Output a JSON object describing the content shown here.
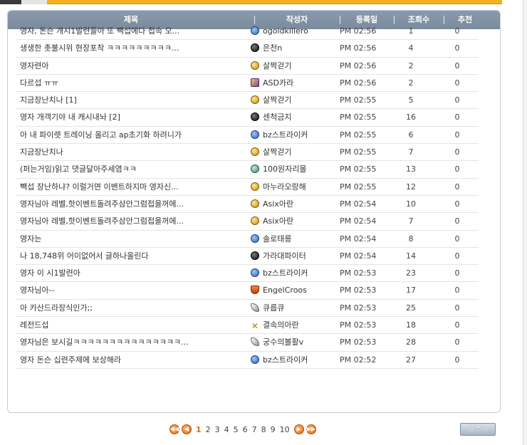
{
  "table": {
    "headers": {
      "title": "제목",
      "author": "작성자",
      "date": "등록일",
      "views": "조회수",
      "recommend": "추천"
    },
    "rows": [
      {
        "title": "영자, 돈슨 개시1발련들아 또 빽섭에다 접속 오...",
        "author": "ogoldkillero",
        "icon": "globe",
        "date": "PM 02:56",
        "views": "1",
        "recommend": "0"
      },
      {
        "title": "생생한 촛불시위 현장포착 ㅋㅋㅋㅋㅋㅋㅋㅋㅋ...",
        "author": "은천n",
        "icon": "round",
        "date": "PM 02:56",
        "views": "4",
        "recommend": "0"
      },
      {
        "title": "영자련아",
        "author": "살짝걷기",
        "icon": "gold",
        "date": "PM 02:56",
        "views": "2",
        "recommend": "0"
      },
      {
        "title": "다르섭 ㅠㅠ",
        "author": "ASD카라",
        "icon": "purple",
        "date": "PM 02:56",
        "views": "2",
        "recommend": "0"
      },
      {
        "title": "지금장난치나 [1]",
        "author": "살짝걷기",
        "icon": "gold",
        "date": "PM 02:55",
        "views": "5",
        "recommend": "0"
      },
      {
        "title": "영자 개객기야 내 캐시내놔 [2]",
        "author": "센척금지",
        "icon": "round",
        "date": "PM 02:55",
        "views": "16",
        "recommend": "0"
      },
      {
        "title": "아 내 파이렛 트레이닝 올리고 ap초기화 하려니가",
        "author": "bz스트라이커",
        "icon": "globe",
        "date": "PM 02:55",
        "views": "6",
        "recommend": "0"
      },
      {
        "title": "지금장난치나",
        "author": "살짝걷기",
        "icon": "gold",
        "date": "PM 02:55",
        "views": "7",
        "recommend": "0"
      },
      {
        "title": "(퍼는거임)읽고 댓글달아주세염ㅋㅋ",
        "author": "100원자리몰",
        "icon": "cyan",
        "date": "PM 02:55",
        "views": "13",
        "recommend": "0"
      },
      {
        "title": "빽섭 장난하냐? 이럴거면 이밴트하지마 영자신...",
        "author": "마누라오랑해",
        "icon": "gold",
        "date": "PM 02:55",
        "views": "12",
        "recommend": "0"
      },
      {
        "title": "영자님아 레벨,핫이벤트돌려주삼안그럼접을꺼에...",
        "author": "Asix아란",
        "icon": "gold",
        "date": "PM 02:54",
        "views": "10",
        "recommend": "0"
      },
      {
        "title": "영자님아 레벨,핫이벤트돌려주삼안그럼접을꺼에...",
        "author": "Asix아란",
        "icon": "gold",
        "date": "PM 02:54",
        "views": "7",
        "recommend": "0"
      },
      {
        "title": "영자는",
        "author": "솔로태릉",
        "icon": "globe",
        "date": "PM 02:54",
        "views": "8",
        "recommend": "0"
      },
      {
        "title": "나 18,748위 어이없어서 글하나올린다",
        "author": "가라대파이터",
        "icon": "round",
        "date": "PM 02:54",
        "views": "14",
        "recommend": "0"
      },
      {
        "title": "영자 이 시1발련아",
        "author": "bz스트라이커",
        "icon": "globe",
        "date": "PM 02:53",
        "views": "23",
        "recommend": "0"
      },
      {
        "title": "영자님아--",
        "author": "EngelCroos",
        "icon": "shield",
        "date": "PM 02:53",
        "views": "17",
        "recommend": "0"
      },
      {
        "title": "아 카산드라장식인가;;",
        "author": "큐릅큐",
        "icon": "feather",
        "date": "PM 02:53",
        "views": "25",
        "recommend": "0"
      },
      {
        "title": "레전드섭",
        "author": "결속의아란",
        "icon": "cross",
        "date": "PM 02:53",
        "views": "18",
        "recommend": "0"
      },
      {
        "title": "영자님은 보시길ㅋㅋㅋㅋㅋㅋㅋㅋㅋㅋㅋㅋㅋㅋㅋ...",
        "author": "궁수의볼활v",
        "icon": "feather",
        "date": "PM 02:53",
        "views": "28",
        "recommend": "0"
      },
      {
        "title": "영자 돈슨 십련주제에 보상해라",
        "author": "bz스트라이커",
        "icon": "globe",
        "date": "PM 02:52",
        "views": "27",
        "recommend": "0"
      }
    ]
  },
  "pager": {
    "pages": [
      "1",
      "2",
      "3",
      "4",
      "5",
      "6",
      "7",
      "8",
      "9",
      "10"
    ],
    "current": "1"
  },
  "write_button": "글쓰기"
}
